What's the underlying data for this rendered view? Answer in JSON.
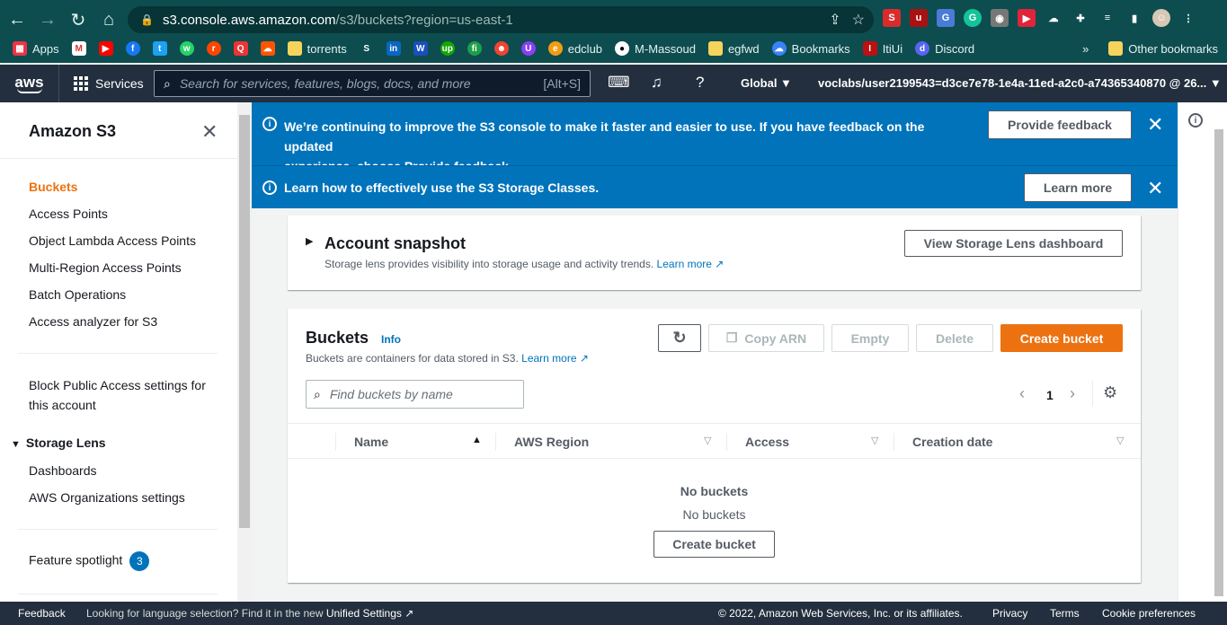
{
  "browser": {
    "url_host": "s3.console.aws.amazon.com",
    "url_path": "/s3/buckets?region=us-east-1",
    "bookmarks": [
      "Apps",
      "torrents",
      "edclub",
      "M-Massoud",
      "egfwd",
      "Bookmarks",
      "ItiUi",
      "Discord"
    ],
    "other_bookmarks": "Other bookmarks",
    "more": "»"
  },
  "aws_nav": {
    "logo": "aws",
    "services": "Services",
    "search_placeholder": "Search for services, features, blogs, docs, and more",
    "search_shortcut": "[Alt+S]",
    "region": "Global ▼",
    "account": "voclabs/user2199543=d3ce7e78-1e4a-11ed-a2c0-a74365340870 @ 26... ▼"
  },
  "sidebar": {
    "title": "Amazon S3",
    "items": [
      "Buckets",
      "Access Points",
      "Object Lambda Access Points",
      "Multi-Region Access Points",
      "Batch Operations",
      "Access analyzer for S3"
    ],
    "block_public_line1": "Block Public Access settings for",
    "block_public_line2": "this account",
    "storage_lens": "Storage Lens",
    "storage_lens_items": [
      "Dashboards",
      "AWS Organizations settings"
    ],
    "feature_spotlight": "Feature spotlight",
    "feature_count": "3"
  },
  "flash": {
    "msg1_part1": "We’re continuing to improve the S3 console to make it faster and easier to use. If you have feedback on the updated",
    "msg1_part2": "experience, choose ",
    "msg1_bold": "Provide feedback",
    "msg1_end": ".",
    "feedback_btn": "Provide feedback",
    "msg2": "Learn how to effectively use the S3 Storage Classes.",
    "learn_btn": "Learn more"
  },
  "snapshot": {
    "title": "Account snapshot",
    "desc": "Storage lens provides visibility into storage usage and activity trends.",
    "learn": "Learn more",
    "btn": "View Storage Lens dashboard"
  },
  "buckets": {
    "title": "Buckets",
    "info": "Info",
    "desc": "Buckets are containers for data stored in S3.",
    "learn": "Learn more",
    "copy_arn": "Copy ARN",
    "empty": "Empty",
    "delete": "Delete",
    "create": "Create bucket",
    "find_placeholder": "Find buckets by name",
    "page": "1",
    "columns": [
      "Name",
      "AWS Region",
      "Access",
      "Creation date"
    ],
    "empty_title": "No buckets",
    "empty_desc": "No buckets",
    "empty_create": "Create bucket"
  },
  "footer": {
    "feedback": "Feedback",
    "language_text": "Looking for language selection? Find it in the new ",
    "unified": "Unified Settings",
    "copyright": "© 2022, Amazon Web Services, Inc. or its affiliates.",
    "privacy": "Privacy",
    "terms": "Terms",
    "cookies": "Cookie preferences"
  },
  "colors": {
    "accent": "#ec7211",
    "flash": "#0073bb",
    "nav": "#232f3e",
    "chrome": "#0d4d4f"
  }
}
